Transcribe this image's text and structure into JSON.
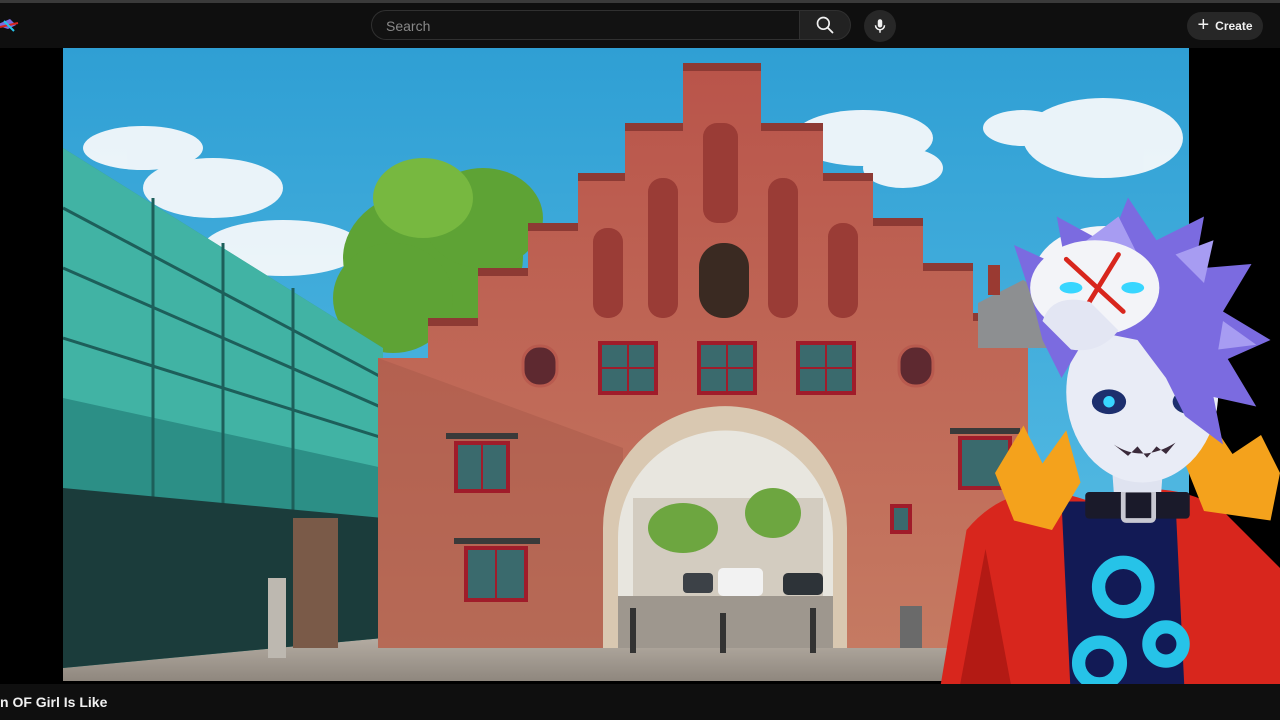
{
  "masthead": {
    "search": {
      "placeholder": "Search",
      "value": ""
    },
    "search_button_icon": "search-icon",
    "mic_button_icon": "microphone-icon",
    "create_label": "Create",
    "create_icon": "plus-icon",
    "logo_icon": "channel-logo-icon"
  },
  "player": {
    "scene": "brick-city-gate",
    "overlay": "vtuber-avatar"
  },
  "video": {
    "title": "n OF Girl Is Like"
  },
  "colors": {
    "background": "#0f0f0f",
    "sky": "#3fa9d6",
    "brick": "#b7564a",
    "window_frame": "#a01c2a",
    "glass_building": "#3aa99a",
    "avatar_jacket": "#d8261d",
    "avatar_hair": "#7b6be0",
    "avatar_shirt": "#26c3e8"
  }
}
